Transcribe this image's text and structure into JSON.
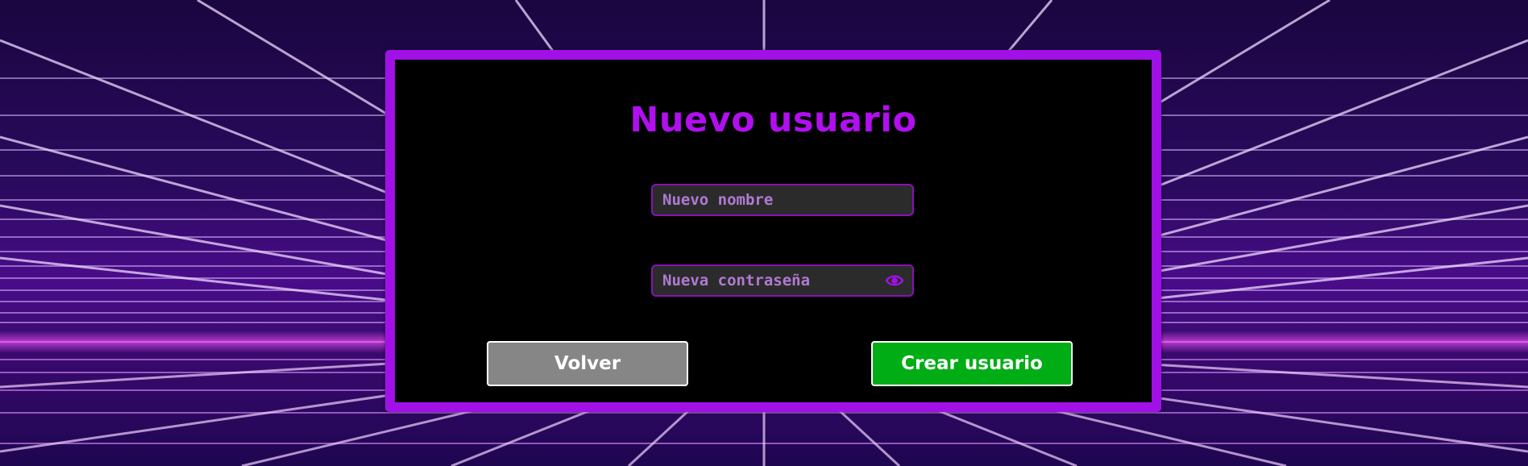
{
  "form": {
    "title": "Nuevo usuario",
    "username_placeholder": "Nuevo nombre",
    "username_value": "",
    "password_placeholder": "Nueva contraseña",
    "password_value": "",
    "toggle_password_icon": "eye-icon",
    "back_label": "Volver",
    "create_label": "Crear usuario"
  },
  "colors": {
    "panel_border": "#a210e8",
    "title": "#b10ff0",
    "field_border": "#8a10b8",
    "field_background": "#2b2b2b",
    "back_button": "#868686",
    "create_button": "#00ad15",
    "background_grid": "#ff5cff"
  }
}
